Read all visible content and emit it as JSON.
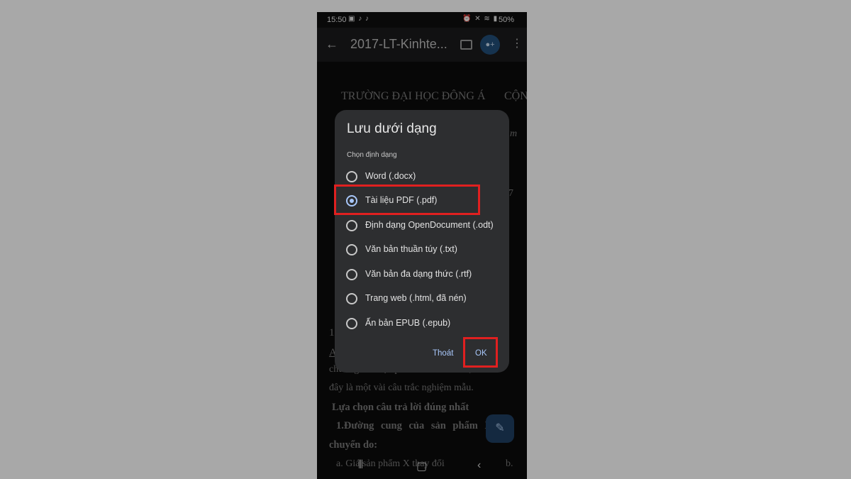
{
  "status_bar": {
    "time": "15:50",
    "battery": "50%",
    "notification_icons": [
      "image-icon",
      "tiktok-icon",
      "tiktok-icon"
    ],
    "system_icons": [
      "alarm-icon",
      "mute-icon",
      "wifi-icon",
      "signal-icon"
    ]
  },
  "app_bar": {
    "title": "2017-LT-Kinhte...",
    "share_glyph": "+"
  },
  "document": {
    "lines": [
      "TRƯỜNG ĐẠI HỌC ĐÔNG Á",
      "CỘN",
      "m",
      "7",
      "1.",
      "A",
      "chương của học phần kinh tế vĩ mô, sau",
      "đây là một vài câu trắc nghiệm mẫu.",
      "Lựa chọn câu trả lời đúng nhất",
      "1.Đường cung của sản phẩm X",
      "chuyển do:",
      "a. Giá sản phẩm X thay đổi",
      "b."
    ]
  },
  "dialog": {
    "title": "Lưu dưới dạng",
    "subtitle": "Chọn định dạng",
    "selected_index": 1,
    "options": [
      "Word (.docx)",
      "Tài liệu PDF (.pdf)",
      "Định dạng OpenDocument (.odt)",
      "Văn bản thuần túy (.txt)",
      "Văn bản đa dạng thức (.rtf)",
      "Trang web (.html, đã nén)",
      "Ấn bản EPUB (.epub)"
    ],
    "cancel_label": "Thoát",
    "ok_label": "OK"
  },
  "colors": {
    "page_background": "#a8a8a8",
    "dialog_background": "#2d2e30",
    "accent": "#a8c7fa",
    "highlight": "#e02020"
  }
}
